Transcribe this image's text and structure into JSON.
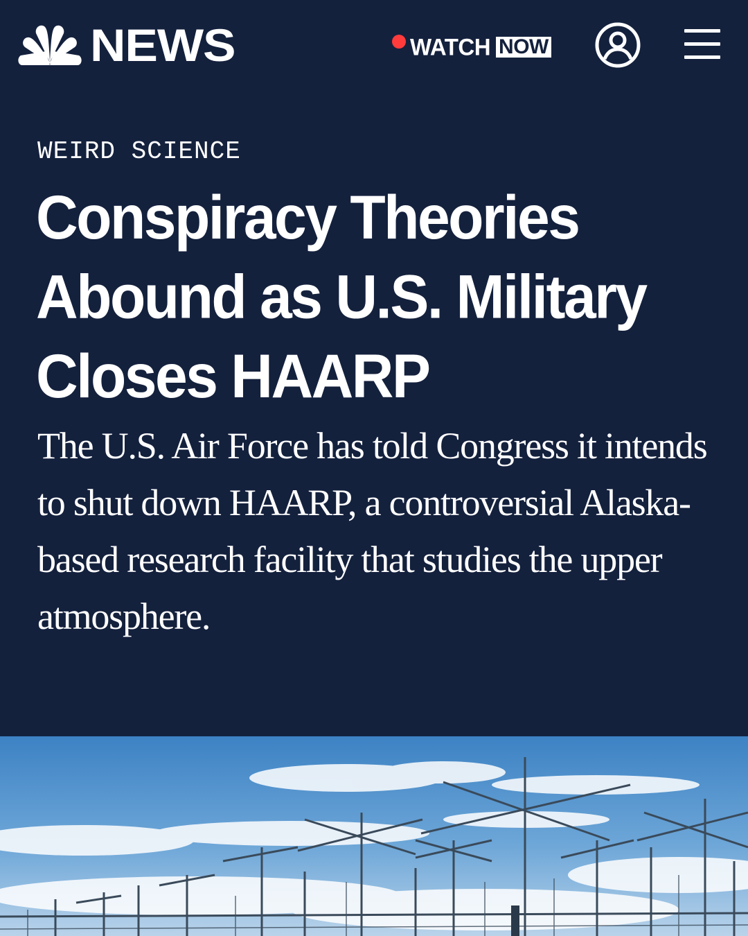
{
  "header": {
    "logo_text": "NEWS",
    "watch_label": "WATCH",
    "watch_badge": "NOW",
    "live_color": "#ff3b3b",
    "account_icon": "user-circle-icon",
    "menu_icon": "hamburger-menu-icon"
  },
  "article": {
    "kicker": "WEIRD SCIENCE",
    "headline": "Conspiracy Theories Abound as U.S. Military Closes HAARP",
    "dek": "The U.S. Air Force has told Congress it intends to shut down HAARP, a controversial Alaska-based research facility that studies the upper atmosphere."
  },
  "theme": {
    "background": "#14213d",
    "text": "#ffffff"
  }
}
